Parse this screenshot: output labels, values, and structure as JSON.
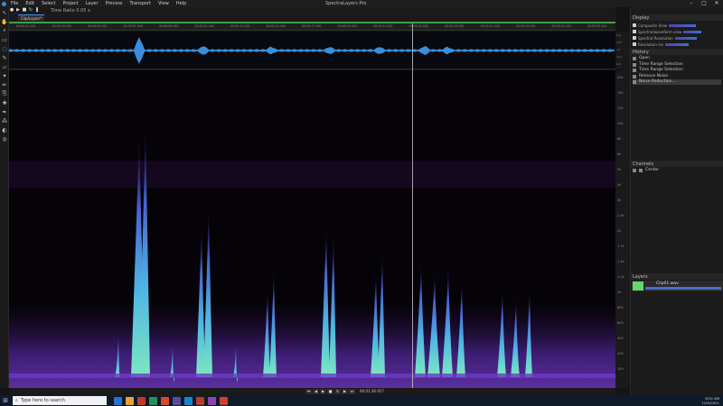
{
  "app": {
    "title": "SpectraLayers Pro",
    "menus": [
      "File",
      "Edit",
      "Select",
      "Project",
      "Layer",
      "Process",
      "Transport",
      "View",
      "Help"
    ]
  },
  "toolbar": {
    "time_selection": "Time Ratio 0.05 x",
    "transport_icons": [
      "record-icon",
      "play-icon",
      "stop-icon",
      "loop-icon",
      "pause-icon"
    ]
  },
  "document": {
    "tab_label": "Clip/Layer/*"
  },
  "ruler": {
    "ticks": [
      "00:00:01.000",
      "00:00:03.000",
      "00:00:05.000",
      "00:00:07.000",
      "00:00:09.000",
      "00:00:11.000",
      "00:00:13.000",
      "00:00:15.000",
      "00:00:17.000",
      "00:00:19.000",
      "00:00:21.000",
      "00:00:23.000",
      "00:00:25.000",
      "00:00:27.000",
      "00:00:29.000",
      "00:00:31.000",
      "00:00:33.000"
    ]
  },
  "waveform_db": [
    "0.0",
    "-6.0",
    "-oo",
    "-6.0",
    "0.0"
  ],
  "frequency_axis": [
    "20k",
    "15k",
    "12k",
    "10k",
    "8k",
    "6k",
    "5k",
    "4k",
    "3k",
    "2.5k",
    "2k",
    "1.7k",
    "1.4k",
    "1.2k",
    "1k",
    "800",
    "600",
    "400",
    "200",
    "100"
  ],
  "display_panel": {
    "title": "Display",
    "rows": [
      "Composite View",
      "Spectral/waveform view",
      "Spectral Resolution",
      "Resolution ms"
    ]
  },
  "history_panel": {
    "title": "History",
    "items": [
      "Open",
      "Time Range Selection",
      "Time Range Selection",
      "Remove Noise",
      "Noise Reduction..."
    ],
    "selected_index": 4
  },
  "channels_panel": {
    "title": "Channels",
    "items": [
      "Center"
    ]
  },
  "layers_panel": {
    "title": "Layers",
    "layer_name": "Clip01.wav",
    "opacity": "100"
  },
  "transport_bottom": {
    "time": "00:01:36.957"
  },
  "taskbar": {
    "search_placeholder": "Type here to search",
    "time": "8:52 AM",
    "date": "1/25/2021",
    "app_colors": [
      "#2a6fd3",
      "#e8a23a",
      "#c0392b",
      "#2c8f5b",
      "#d64a2a",
      "#5b4aa0",
      "#1b83d0",
      "#c0392b",
      "#8e44ad",
      "#d63a3a"
    ]
  },
  "colors": {
    "accent": "#3aa14b",
    "waveform": "#3b8fd8",
    "spectrogram_low": "#3b1c70",
    "spectrogram_high": "#5fd7e6"
  }
}
